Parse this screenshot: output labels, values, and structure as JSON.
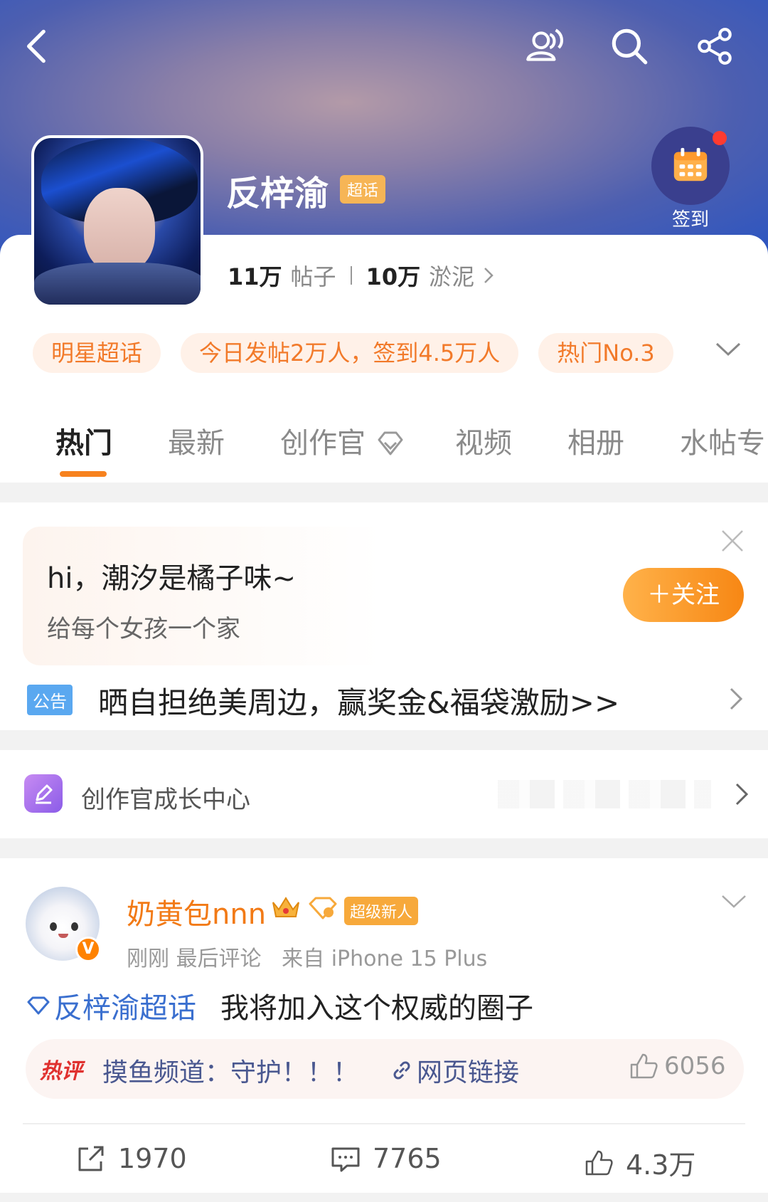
{
  "header": {
    "back_icon": "back-arrow-icon",
    "friends_icon": "people-icon",
    "search_icon": "search-icon",
    "share_icon": "share-icon"
  },
  "supertopic": {
    "name": "反梓渝",
    "badge": "超话",
    "checkin_label": "签到",
    "posts_count": "11万",
    "posts_label": "帖子",
    "members_count": "10万",
    "members_label": "淤泥",
    "tags": [
      "明星超话",
      "今日发帖2万人，签到4.5万人",
      "热门No.3"
    ]
  },
  "tabs": [
    "热门",
    "最新",
    "创作官",
    "视频",
    "相册",
    "水帖专"
  ],
  "community": {
    "title": "hi，潮汐是橘子味~",
    "subtitle": "给每个女孩一个家",
    "follow_label": "＋关注",
    "notice_badge": "公告",
    "notice_text": "晒自担绝美周边，赢奖金&福袋激励>>"
  },
  "growth_center": {
    "label": "创作官成长中心"
  },
  "post": {
    "username": "奶黄包nnn",
    "vip_badge": "V",
    "rank_badge": "超级新人",
    "meta_time": "刚刚",
    "meta_action": "最后评论",
    "meta_source": "来自 iPhone 15 Plus",
    "topic": "反梓渝超话",
    "content": "我将加入这个权威的圈子",
    "hot_comment": {
      "tag": "热评",
      "text": "摸鱼频道：守护！！！",
      "link_label": "网页链接",
      "likes": "6056"
    },
    "actions": {
      "shares": "1970",
      "comments": "7765",
      "likes": "4.3万"
    }
  },
  "colors": {
    "accent_orange": "#f7821e",
    "topic_blue": "#3a6fcf",
    "username_orange": "#f27a16"
  }
}
